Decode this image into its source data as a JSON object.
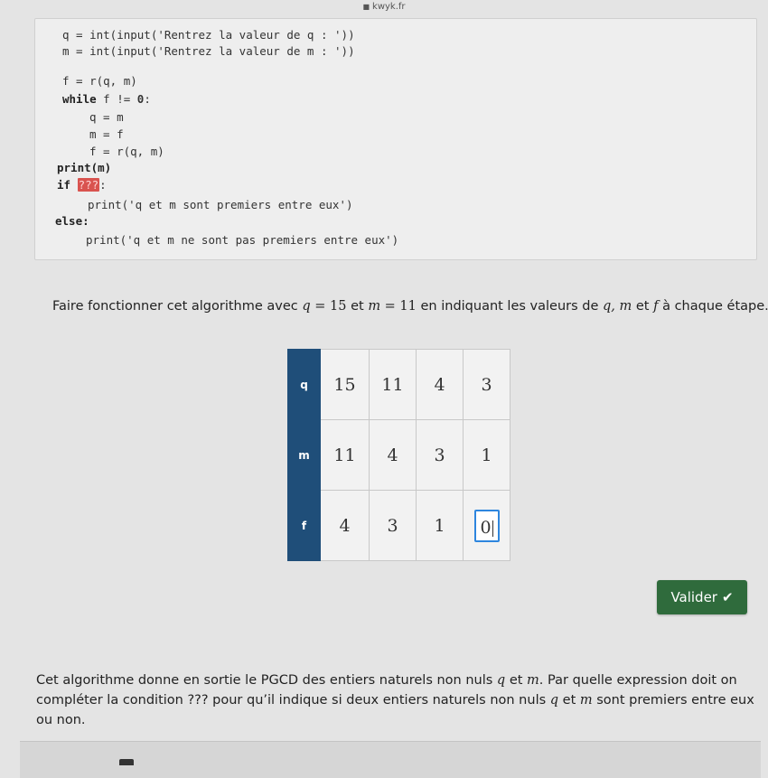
{
  "browser": {
    "domain": "kwyk.fr"
  },
  "code": {
    "line1": "q = int(input('Rentrez la valeur de q : '))",
    "line2": "m = int(input('Rentrez la valeur de m : '))",
    "line3_pre": "f = r(q, m)",
    "line4_kw": "while",
    "line4_mid": " f != ",
    "line4_num": "0",
    "line4_end": ":",
    "line5": "q = m",
    "line6": "m = f",
    "line7": "f = r(q, m)",
    "line8": "print(m)",
    "line9_kw": "if",
    "line9_blank": "???",
    "line9_end": ":",
    "line10": "print('q et m sont premiers entre eux')",
    "line11": "else:",
    "line12": "print('q et m ne sont pas premiers entre eux')"
  },
  "prompt": {
    "before": "Faire fonctionner cet algorithme avec ",
    "q_var": "q",
    "eq1": " = 15",
    "and": " et ",
    "m_var": "m",
    "eq2": " = 11",
    "after": " en indiquant les valeurs de ",
    "vars": "q, m",
    "et": " et ",
    "f_var": "f",
    "end": " à chaque étape."
  },
  "table": {
    "rows": [
      {
        "label": "q",
        "values": [
          "15",
          "11",
          "4",
          "3"
        ]
      },
      {
        "label": "m",
        "values": [
          "11",
          "4",
          "3",
          "1"
        ]
      },
      {
        "label": "f",
        "values": [
          "4",
          "3",
          "1"
        ],
        "input_value": "0"
      }
    ]
  },
  "valider_label": "Valider",
  "conclusion": {
    "part1": "Cet algorithme donne en sortie le PGCD des entiers naturels non nuls ",
    "q": "q",
    "et": " et ",
    "m": "m",
    "part2": ". Par quelle expression doit on compléter la condition ??? pour qu’il indique si deux entiers naturels non nuls ",
    "q2": "q",
    "et2": " et ",
    "m2": "m",
    "part3": " sont premiers entre eux ou non."
  },
  "icons": {
    "lock": "lock-icon",
    "check": "check-icon"
  },
  "colors": {
    "header_blue": "#1f4e79",
    "valider_green": "#2f6b3c",
    "blank_red": "#d9534f",
    "input_border": "#2e86de"
  }
}
